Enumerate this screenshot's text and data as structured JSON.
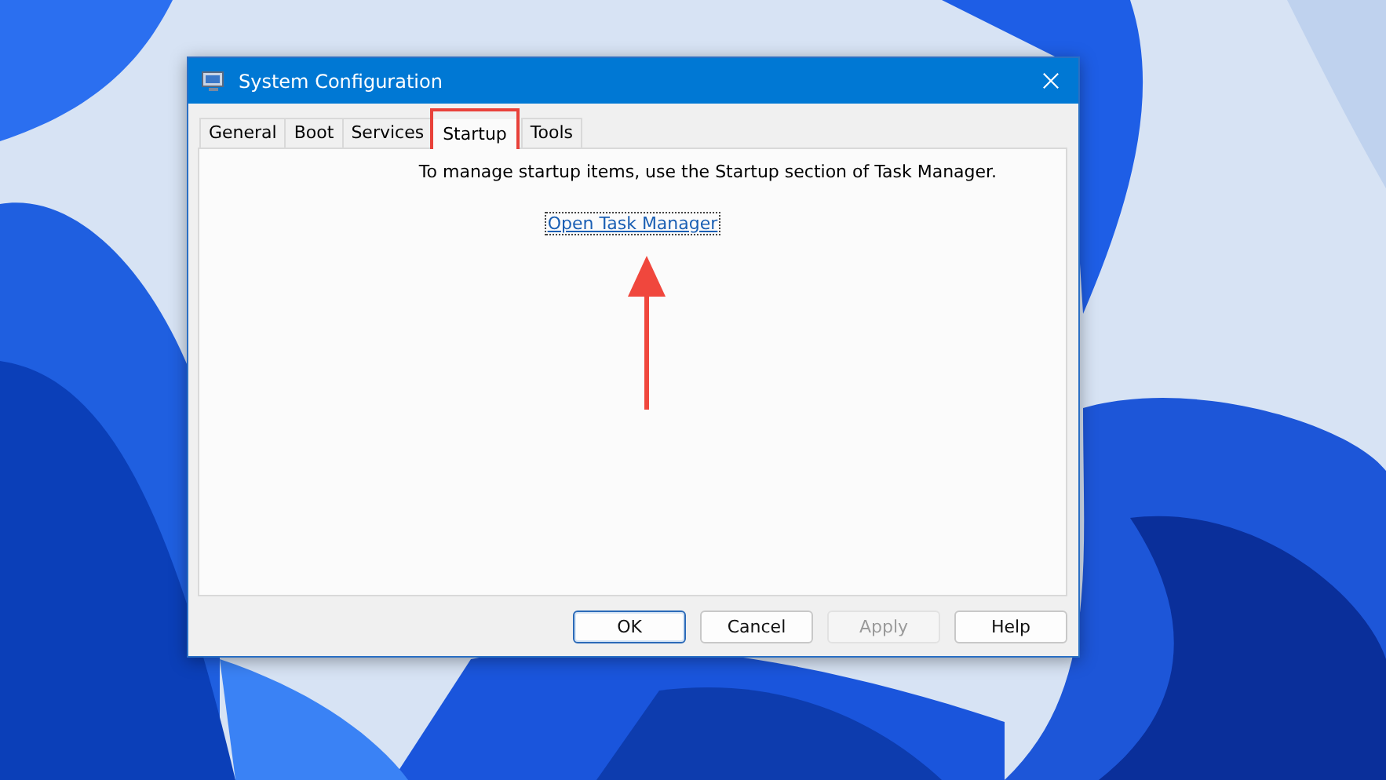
{
  "window": {
    "title": "System Configuration"
  },
  "tabs": [
    {
      "label": "General",
      "selected": false
    },
    {
      "label": "Boot",
      "selected": false
    },
    {
      "label": "Services",
      "selected": false
    },
    {
      "label": "Startup",
      "selected": true
    },
    {
      "label": "Tools",
      "selected": false
    }
  ],
  "panel": {
    "message": "To manage startup items, use the Startup section of Task Manager.",
    "link": "Open Task Manager"
  },
  "buttons": [
    {
      "label": "OK",
      "default": true,
      "disabled": false
    },
    {
      "label": "Cancel",
      "default": false,
      "disabled": false
    },
    {
      "label": "Apply",
      "default": false,
      "disabled": true
    },
    {
      "label": "Help",
      "default": false,
      "disabled": false
    }
  ]
}
